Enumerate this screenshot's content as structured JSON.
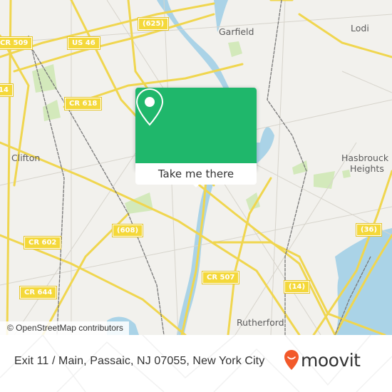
{
  "map": {
    "towns": [
      {
        "name": "Garfield"
      },
      {
        "name": "Lodi"
      },
      {
        "name": "Clifton"
      },
      {
        "name": "Hasbrouck"
      },
      {
        "name": "Heights"
      },
      {
        "name": "Rutherford"
      }
    ],
    "shields": [
      {
        "label": "CR 509"
      },
      {
        "label": "US 46"
      },
      {
        "label": "(625)"
      },
      {
        "label": "CR 618"
      },
      {
        "label": "14"
      },
      {
        "label": "(608)"
      },
      {
        "label": "CR 602"
      },
      {
        "label": "CR 644"
      },
      {
        "label": "CR 507"
      },
      {
        "label": "(14)"
      },
      {
        "label": "(36)"
      }
    ],
    "attribution": "© OpenStreetMap contributors",
    "colors": {
      "land": "#f2f1ed",
      "road": "#f7e26b",
      "water": "#a9d3e6",
      "park": "#cfe8b5",
      "rail": "#777777"
    }
  },
  "popup": {
    "icon": "location-pin-icon",
    "button_label": "Take me there",
    "accent": "#1fb76b"
  },
  "footer": {
    "address": "Exit 11 / Main, Passaic, NJ 07055, New York City",
    "brand": "moovit",
    "brand_icon": "moovit-pin-smile-icon",
    "brand_color": "#f2592a"
  }
}
